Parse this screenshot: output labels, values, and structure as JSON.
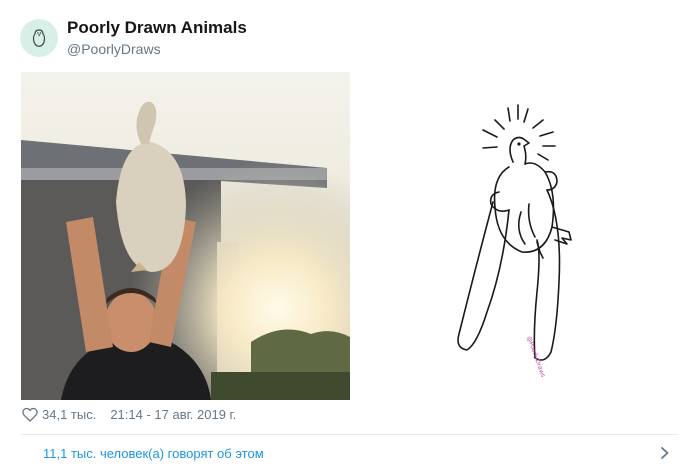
{
  "tweet": {
    "author": {
      "display_name": "Poorly Drawn Animals",
      "handle": "@PoorlyDraws",
      "avatar_icon": "bird-icon"
    },
    "media": {
      "photo_description_icon": "photo",
      "drawing_signature": "@PoorlyDraws"
    },
    "meta": {
      "like_icon": "heart-icon",
      "likes": "34,1 тыс.",
      "timestamp": "21:14 - 17 авг. 2019 г."
    },
    "footer": {
      "people_talking": "11,1 тыс. человек(а) говорят об этом",
      "chevron_icon": "chevron-right-icon"
    }
  },
  "colors": {
    "link": "#1b95e0",
    "muted": "#657786",
    "text": "#14171a",
    "divider": "#e6ecf0",
    "avatar_bg": "#d7efe7"
  }
}
